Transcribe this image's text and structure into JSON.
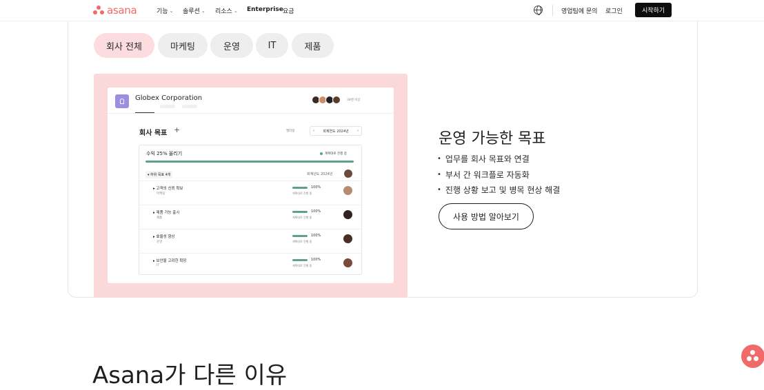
{
  "nav": {
    "logo_text": "asana",
    "items": [
      "기능",
      "솔루션",
      "리소스"
    ],
    "enterprise": "Enterprise",
    "pricing": "요금",
    "contact_sales": "영업팀에 문의",
    "login": "로그인",
    "start": "시작하기"
  },
  "tabs": [
    "회사 전체",
    "마케팅",
    "운영",
    "IT",
    "제품"
  ],
  "preview": {
    "org_name": "Globex Corporation",
    "members": "38명 이상",
    "goals_title": "회사 목표",
    "filter": "필터링",
    "period": "회계연도 2024년",
    "main_goal": "수익 25% 올리기",
    "main_status": "계획대로 진행 중",
    "sub_toggle": "하위 목표 4개",
    "sub_period": "회계년도 2024년",
    "rows": [
      {
        "title": "고객의 신뢰 확보",
        "team": "마케팅",
        "pct": "100%",
        "status": "계획대로 진행 중"
      },
      {
        "title": "제품 기능 출시",
        "team": "제품",
        "pct": "100%",
        "status": "계획대로 진행 중"
      },
      {
        "title": "효율성 향상",
        "team": "운영",
        "pct": "100%",
        "status": "계획대로 진행 중"
      },
      {
        "title": "보안을 고려한 확장",
        "team": "IT",
        "pct": "100%",
        "status": "계획대로 진행 중"
      }
    ]
  },
  "feature": {
    "heading": "운영 가능한 목표",
    "bullets": [
      "업무를 회사 목표와 연결",
      "부서 간 워크플로 자동화",
      "진행 상황 보고 및 병목 현상 해결"
    ],
    "cta": "사용 방법 알아보기"
  },
  "bottom_heading": "Asana가 다른 이유",
  "colors": {
    "brand": "#f06a6a",
    "active_tab": "#fcdcde",
    "progress": "#5da283"
  }
}
